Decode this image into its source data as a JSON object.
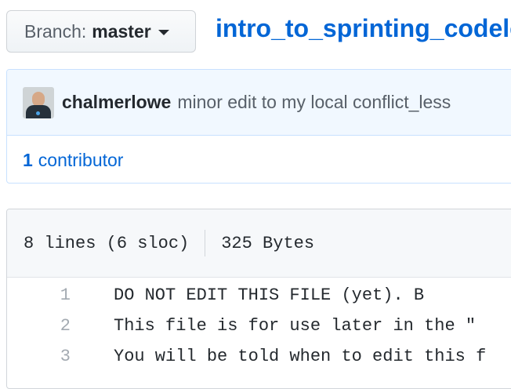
{
  "branch": {
    "label": "Branch:",
    "name": "master"
  },
  "path": {
    "filename": "intro_to_sprinting_codele"
  },
  "commit": {
    "author": "chalmerlowe",
    "message": "minor edit to my local conflict_less"
  },
  "contributors": {
    "count": "1",
    "label": "contributor"
  },
  "file_info": {
    "lines": "8 lines (6 sloc)",
    "size": "325 Bytes"
  },
  "code_lines": [
    {
      "num": "1",
      "text": "DO NOT EDIT THIS FILE (yet). B"
    },
    {
      "num": "2",
      "text": "This file is for use later in the \""
    },
    {
      "num": "3",
      "text": "You will be told when to edit this f"
    }
  ]
}
